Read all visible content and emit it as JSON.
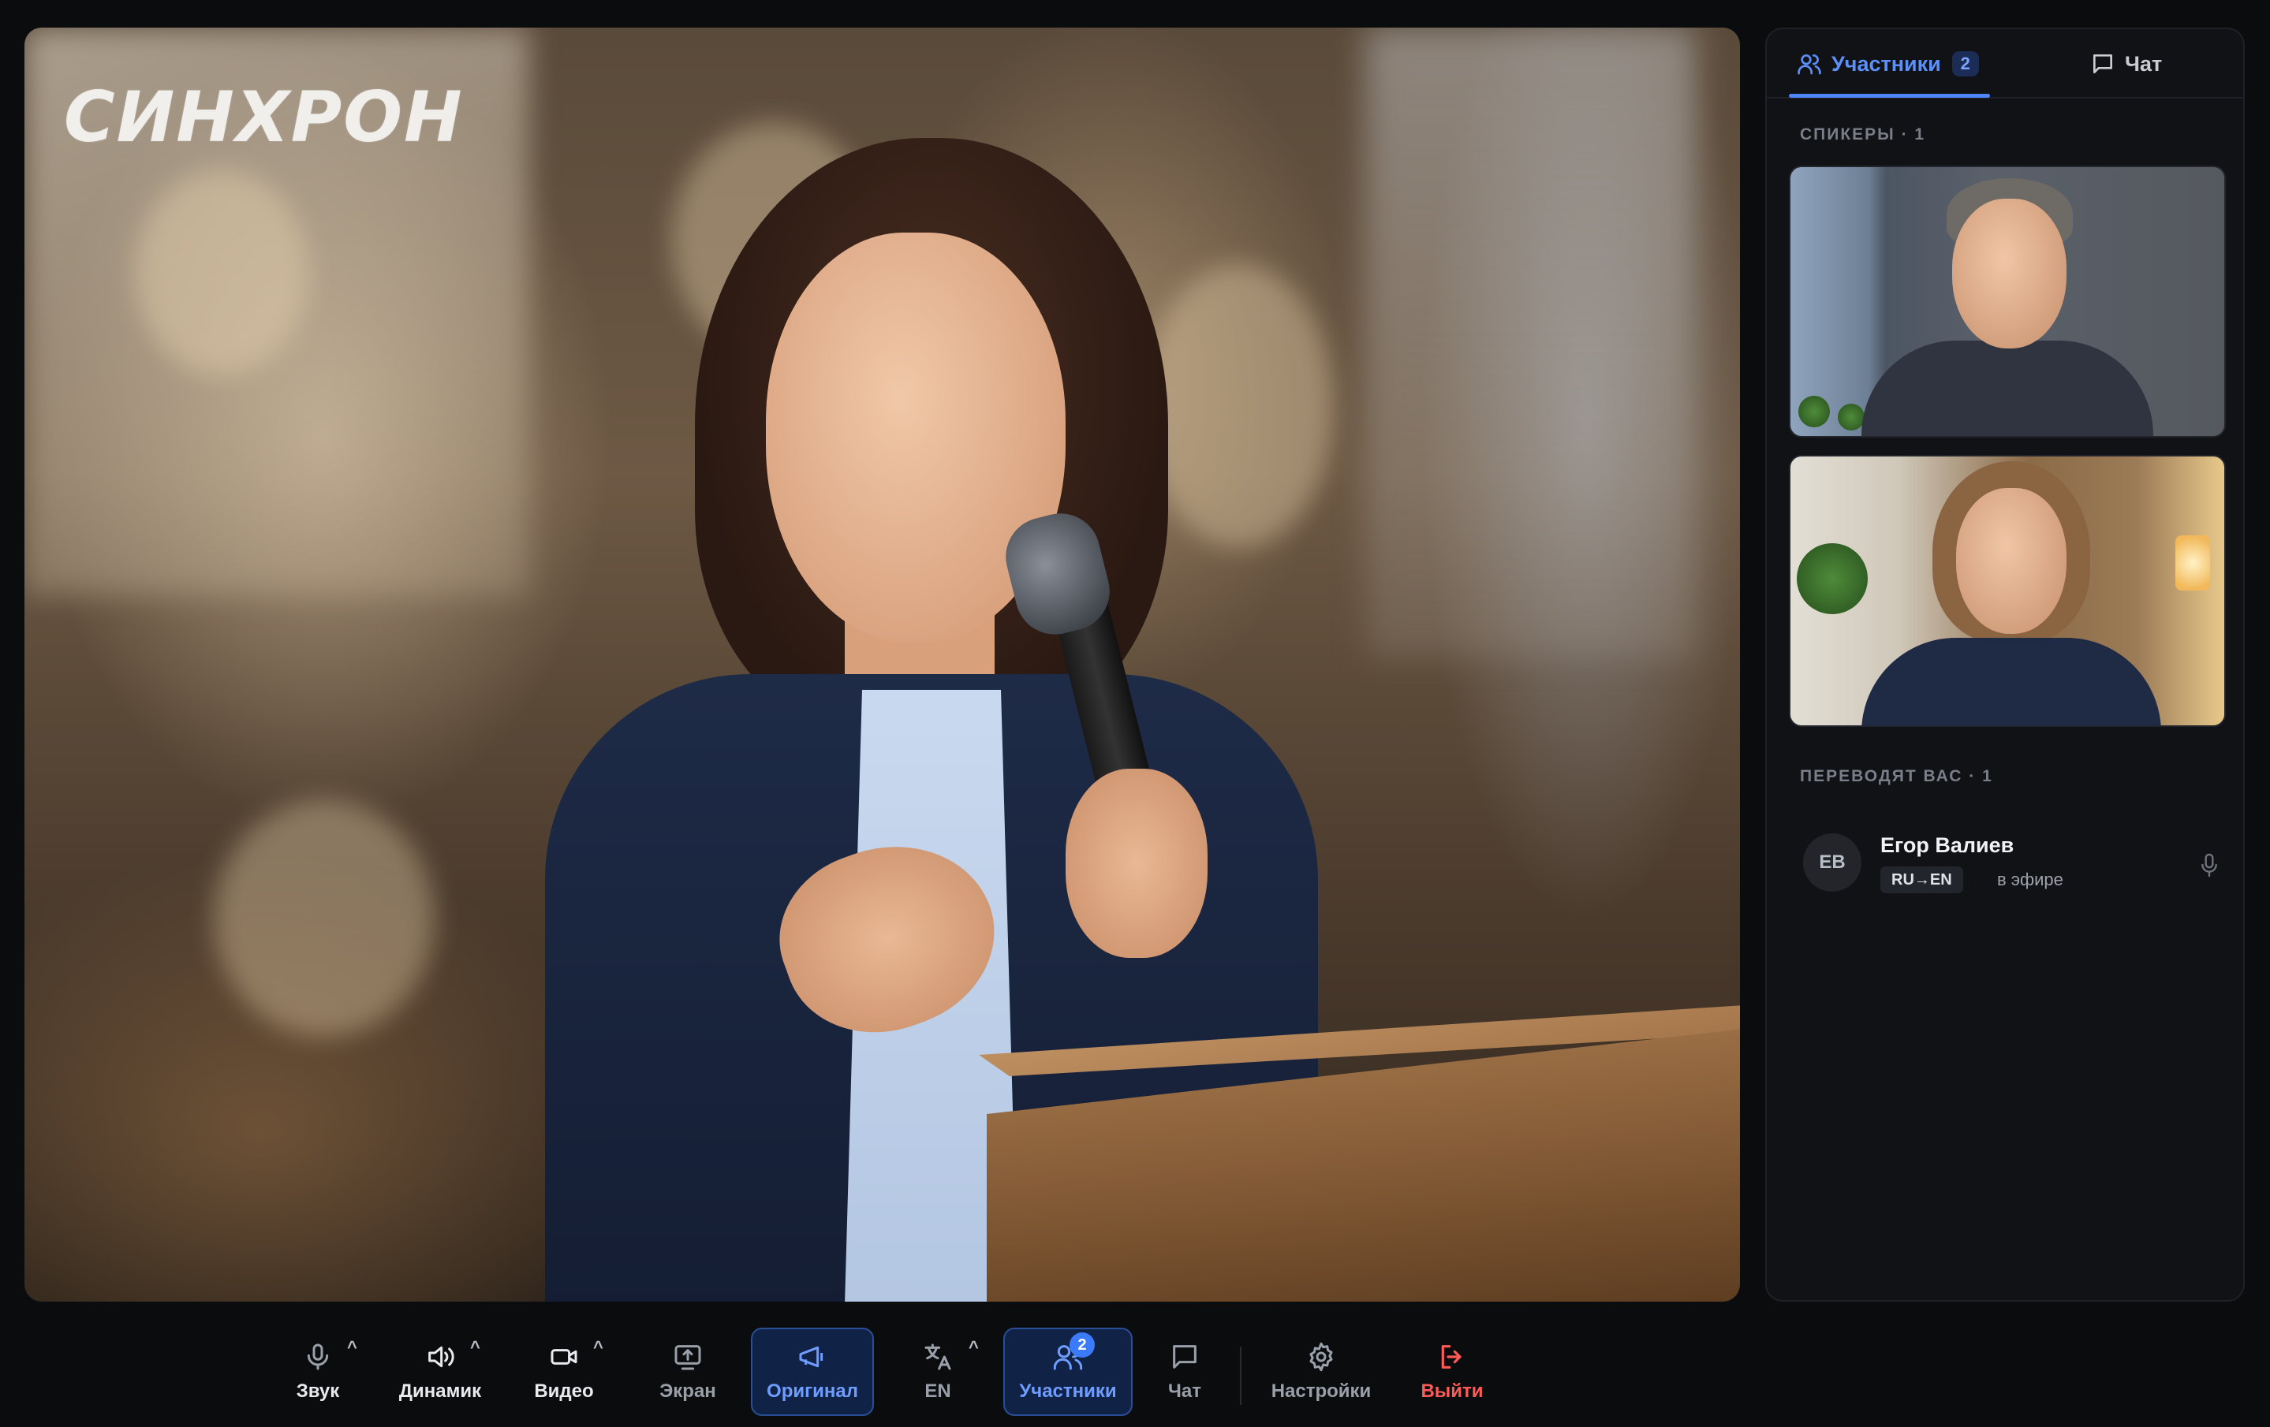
{
  "stage": {
    "logo_text": "СИНХРОН"
  },
  "side_panel": {
    "tabs": [
      {
        "label": "Участники",
        "badge": "2",
        "icon": "users-icon",
        "active": true
      },
      {
        "label": "Чат",
        "icon": "chat-icon",
        "active": false
      }
    ],
    "speakers_title": "СПИКЕРЫ · 1",
    "translators_title": "ПЕРЕВОДЯТ ВАС · 1",
    "translator": {
      "initials": "ЕВ",
      "name": "Егор Валиев",
      "pair": "RU→EN",
      "status": "в эфире",
      "icon": "microphone-icon"
    }
  },
  "toolbar": {
    "buttons": [
      {
        "label": "Звук",
        "icon": "microphone-icon",
        "caret": true
      },
      {
        "label": "Динамик",
        "icon": "speaker-icon",
        "caret": true
      },
      {
        "label": "Видео",
        "icon": "camera-icon",
        "caret": true
      },
      {
        "label": "Экран",
        "icon": "screen-share-icon"
      },
      {
        "label": "Оригинал",
        "icon": "megaphone-icon",
        "active": true
      },
      {
        "label": "EN",
        "icon": "translate-icon",
        "caret": true
      },
      {
        "label": "Участники",
        "icon": "users-icon",
        "active": true,
        "badge": "2"
      },
      {
        "label": "Чат",
        "icon": "chat-icon"
      },
      {
        "label": "Настройки",
        "icon": "gear-icon"
      },
      {
        "label": "Выйти",
        "icon": "exit-icon",
        "danger": true
      }
    ]
  },
  "colors": {
    "accent": "#4f86f7",
    "danger": "#ff5a55",
    "background": "#0b0c0e",
    "panel": "#111216"
  }
}
